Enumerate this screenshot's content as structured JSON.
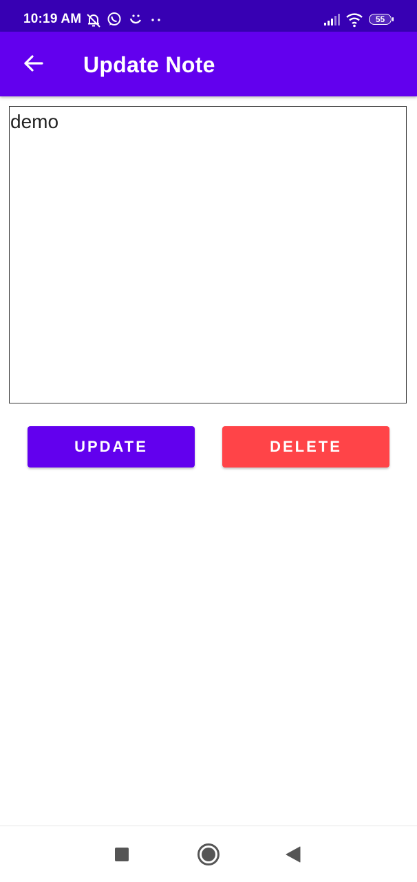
{
  "status_bar": {
    "time": "10:19 AM",
    "battery": "55",
    "icons": [
      "alarm-off-icon",
      "whatsapp-icon",
      "smile-notification-icon",
      "more-dots-icon",
      "signal-icon",
      "wifi-icon",
      "battery-icon"
    ]
  },
  "app_bar": {
    "title": "Update Note",
    "back_icon": "arrow-left-icon"
  },
  "note": {
    "value": "demo"
  },
  "actions": {
    "update_label": "UPDATE",
    "delete_label": "DELETE"
  },
  "colors": {
    "status_bar": "#3700b3",
    "primary": "#6200ee",
    "delete": "#ff4448"
  },
  "nav_bar": {
    "icons": [
      "recents-square-icon",
      "home-circle-icon",
      "back-triangle-icon"
    ]
  }
}
